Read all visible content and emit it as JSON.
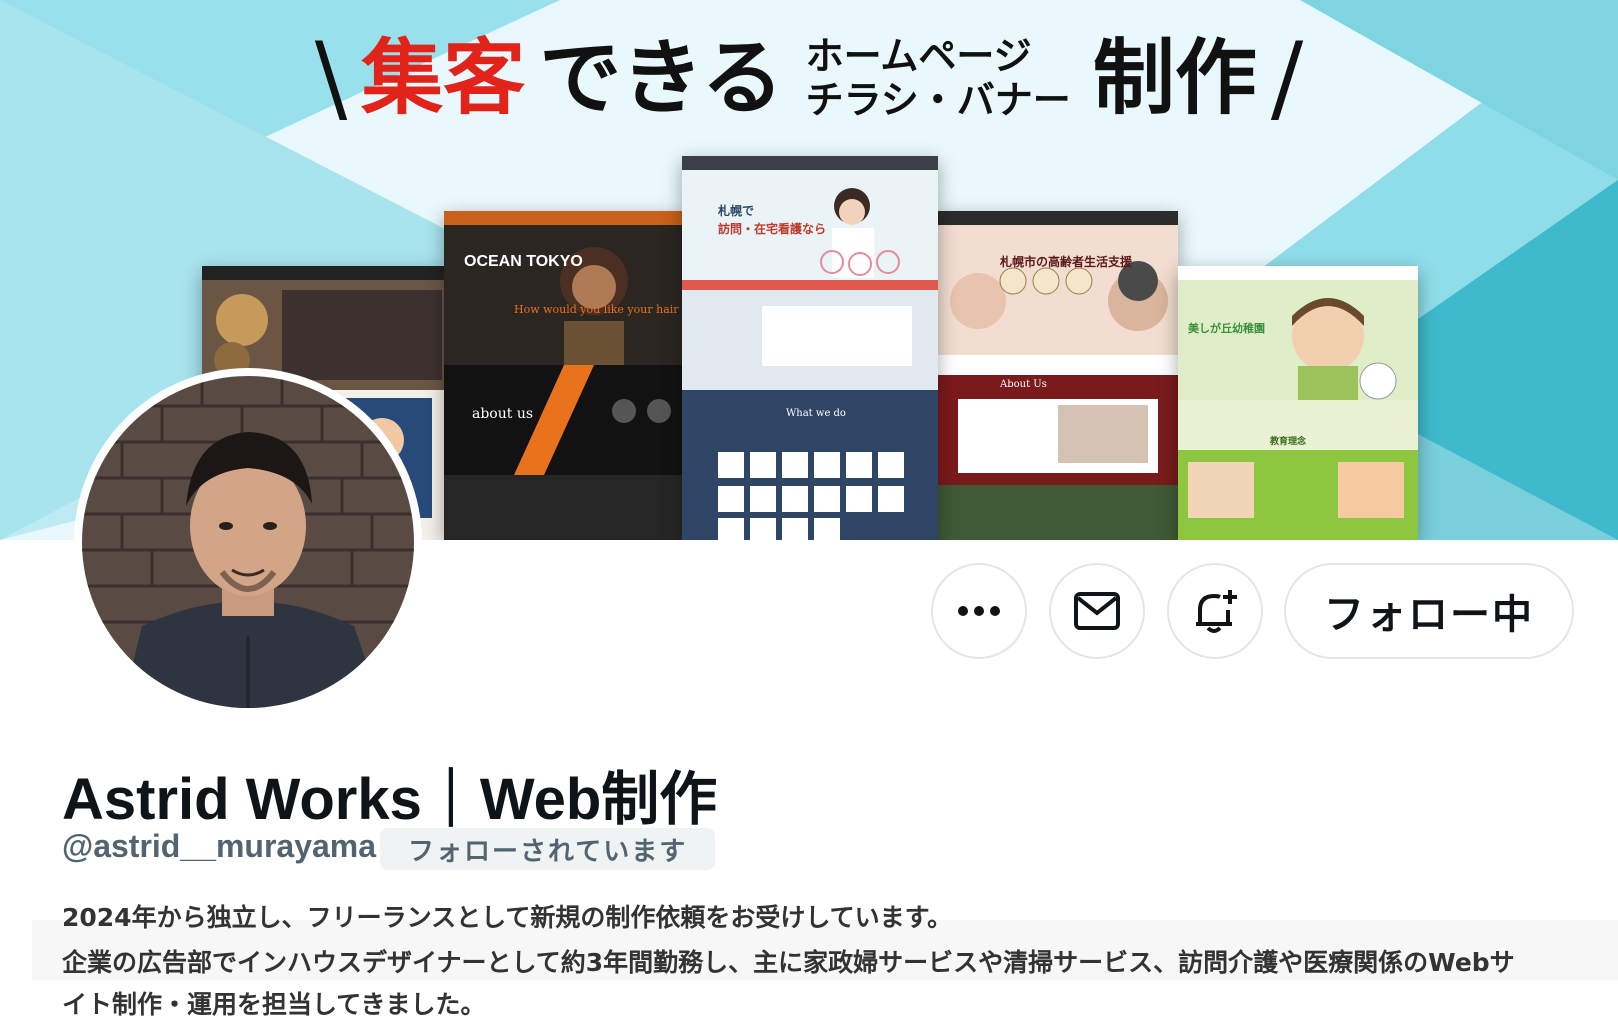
{
  "banner": {
    "title_red": "集客",
    "title_black": "できる",
    "title_stack_top": "ホームページ",
    "title_stack_bottom": "チラシ・バナー",
    "title_end": "制作",
    "slash_left": "\\",
    "slash_right": "/",
    "shots": {
      "ocean_title": "OCEAN TOKYO",
      "ocean_tagline": "How would you like your hair cut?",
      "ocean_about": "about us",
      "care_heading_1": "札幌で",
      "care_heading_2": "訪問・在宅看護なら",
      "care_what": "What we do",
      "elderly_heading": "札幌市の高齢者生活支援",
      "elderly_about": "About Us",
      "kinder_name": "美しが丘幼稚園",
      "kinder_section": "教育理念"
    }
  },
  "profile": {
    "display_name": "Astrid Works｜Web制作",
    "handle": "@astrid__murayama",
    "follows_you": "フォローされています",
    "bio_lines": [
      "2024年から独立し、フリーランスとして新規の制作依頼をお受けしています。",
      "企業の広告部でインハウスデザイナーとして約3年間勤務し、主に家政婦サービスや清掃サービス、訪問介護や医療関係のWebサ",
      "イト制作・運用を担当してきました。"
    ]
  },
  "actions": {
    "more_icon": "more-horizontal-icon",
    "message_icon": "envelope-icon",
    "notify_icon": "bell-plus-icon",
    "follow_label": "フォロー中"
  },
  "colors": {
    "accent_red": "#e2231a",
    "banner_cyan": "#8fdde9",
    "text_primary": "#0f1419",
    "text_secondary": "#536471"
  }
}
